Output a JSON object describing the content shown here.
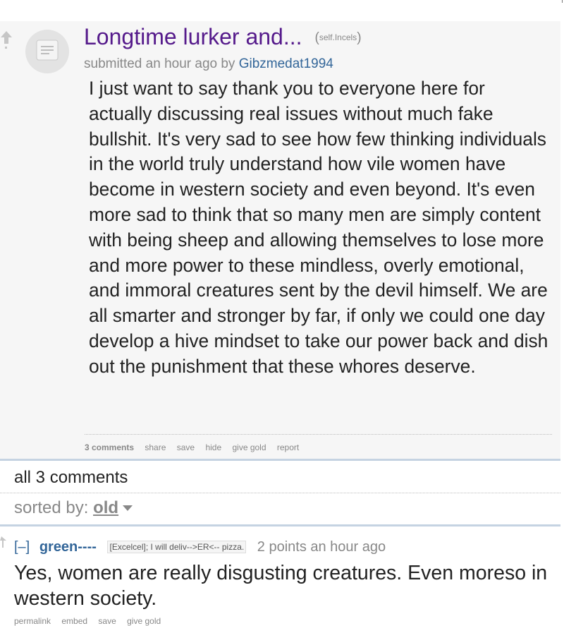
{
  "post": {
    "title": "Longtime lurker and...",
    "domain": "self.Incels",
    "tagline_prefix": "submitted an hour ago by",
    "author": "Gibzmedat1994",
    "selftext": "I just want to say thank you to everyone here for actually discussing real issues without much fake bullshit. It's very sad to see how few thinking individuals in the world truly understand how vile women have become in western society and even beyond. It's even more sad to think that so many men are simply content with being sheep and allowing themselves to lose more and more power to these mindless, overly emotional, and immoral creatures sent by the devil himself. We are all smarter and stronger by far, if only we could one day develop a hive mindset to take our power back and dish out the punishment that these whores deserve.",
    "buttons": {
      "comments": "3 comments",
      "share": "share",
      "save": "save",
      "hide": "hide",
      "give_gold": "give gold",
      "report": "report"
    }
  },
  "comments_header": {
    "all_comments": "all 3 comments",
    "sorted_label": "sorted by:",
    "sort_value": "old"
  },
  "comment": {
    "collapse": "[–]",
    "author": "green----",
    "flair": "[Excelcel]; I will deliv-->ER<-- pizza.",
    "score": "2 points an hour ago",
    "body": "Yes, women are really disgusting creatures. Even moreso in western society.",
    "buttons": {
      "permalink": "permalink",
      "embed": "embed",
      "save": "save",
      "give_gold": "give gold"
    }
  },
  "colors": {
    "title_visited": "#551a8b",
    "author_link": "#336699",
    "muted": "#888888",
    "panel_bg": "#f6f6f6",
    "divider": "#c5d3e2"
  },
  "icons": {
    "upvote": "up-arrow-icon",
    "thumbnail": "self-post-text-icon",
    "sort_caret": "caret-down-icon"
  }
}
